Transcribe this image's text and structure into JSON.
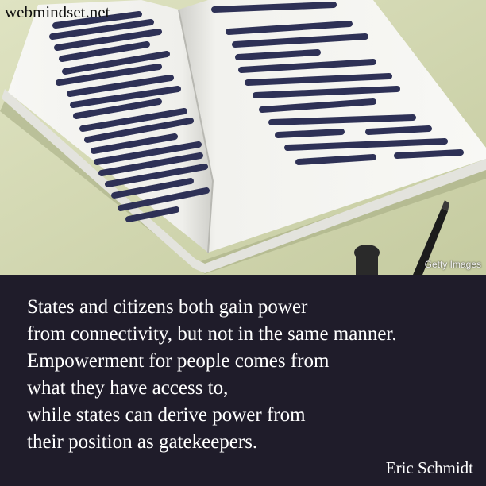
{
  "site": {
    "label": "webmindset.net"
  },
  "photo": {
    "credit": "Getty Images"
  },
  "quote": {
    "lines": [
      "States and citizens both gain power",
      "from connectivity, but not in the same manner.",
      "Empowerment for people comes from",
      "what they have access to,",
      "while states can derive power from",
      "their position as gatekeepers."
    ],
    "author": "Eric Schmidt"
  },
  "colors": {
    "background": "#d7dcb6",
    "panel": "#1f1c2a",
    "text": "#ffffff",
    "redaction": "#2e3156"
  }
}
